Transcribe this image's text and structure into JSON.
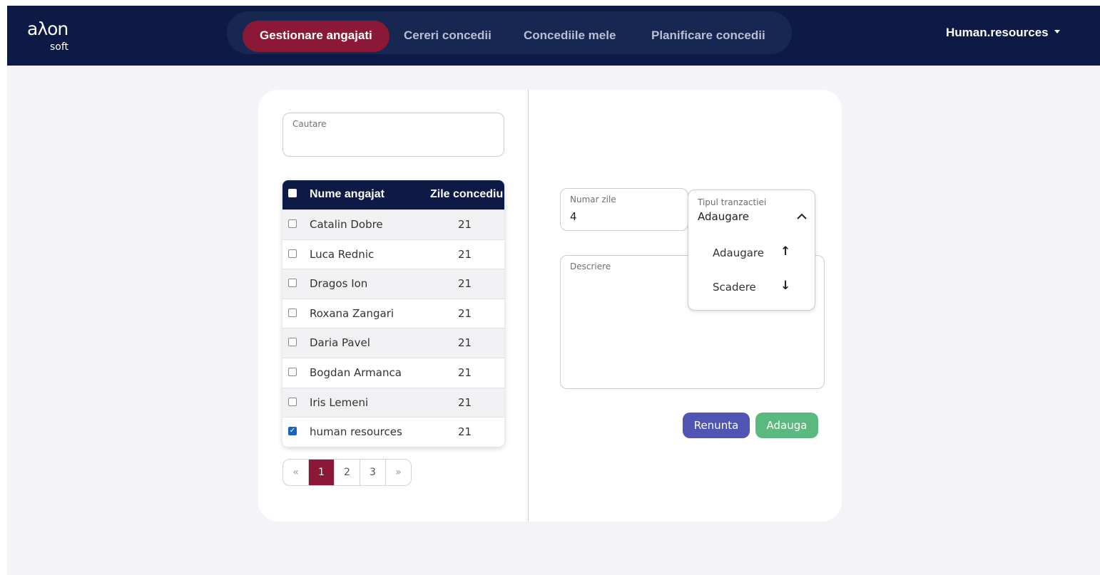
{
  "brand": {
    "logo_main": "aλon",
    "logo_sub": "soft"
  },
  "nav": {
    "tabs": [
      {
        "label": "Gestionare angajati",
        "active": true
      },
      {
        "label": "Cereri concedii",
        "active": false
      },
      {
        "label": "Concediile mele",
        "active": false
      },
      {
        "label": "Planificare concedii",
        "active": false
      }
    ],
    "user": "Human.resources"
  },
  "search": {
    "label": "Cautare",
    "value": ""
  },
  "employees_table": {
    "headers": {
      "name": "Nume angajat",
      "days": "Zile concediu"
    },
    "rows": [
      {
        "name": "Catalin Dobre",
        "days": "21",
        "checked": false
      },
      {
        "name": "Luca Rednic",
        "days": "21",
        "checked": false
      },
      {
        "name": "Dragos Ion",
        "days": "21",
        "checked": false
      },
      {
        "name": "Roxana Zangari",
        "days": "21",
        "checked": false
      },
      {
        "name": "Daria Pavel",
        "days": "21",
        "checked": false
      },
      {
        "name": "Bogdan Armanca",
        "days": "21",
        "checked": false
      },
      {
        "name": "Iris Lemeni",
        "days": "21",
        "checked": false
      },
      {
        "name": "human resources",
        "days": "21",
        "checked": true
      }
    ]
  },
  "pagination": {
    "prev": "«",
    "pages": [
      "1",
      "2",
      "3"
    ],
    "current": "1",
    "next": "»"
  },
  "form": {
    "days_label": "Numar zile",
    "days_value": "4",
    "type_label": "Tipul tranzactiei",
    "type_value": "Adaugare",
    "type_options": [
      {
        "label": "Adaugare",
        "arrow": "↑"
      },
      {
        "label": "Scadere",
        "arrow": "↓"
      }
    ],
    "description_label": "Descriere",
    "description_value": "",
    "cancel_label": "Renunta",
    "submit_label": "Adauga"
  },
  "colors": {
    "navbar": "#0c1a45",
    "accent": "#8c1838",
    "cancel_button": "#5055b4",
    "submit_button": "#5bb87e",
    "checkbox_checked": "#1565c0"
  }
}
